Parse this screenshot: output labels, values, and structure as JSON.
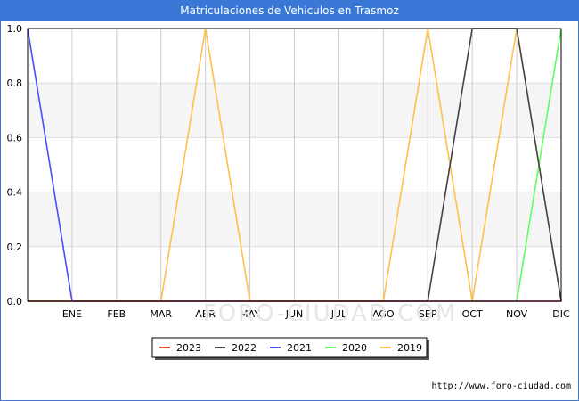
{
  "chart_data": {
    "type": "line",
    "title": "Matriculaciones de Vehiculos en Trasmoz",
    "xlabel": "",
    "ylabel": "",
    "ylim": [
      0,
      1
    ],
    "yticks": [
      0.0,
      0.2,
      0.4,
      0.6,
      0.8,
      1.0
    ],
    "ytick_labels": [
      "0.0",
      "0.2",
      "0.4",
      "0.6",
      "0.8",
      "1.0"
    ],
    "categories": [
      "",
      "ENE",
      "FEB",
      "MAR",
      "ABR",
      "MAY",
      "JUN",
      "JUL",
      "AGO",
      "SEP",
      "OCT",
      "NOV",
      "DIC"
    ],
    "grid": true,
    "legend_position": "bottom",
    "watermark": "FORO-CIUDAD.COM",
    "series": [
      {
        "name": "2023",
        "color": "#ff3b3b",
        "values": [
          0,
          0,
          0,
          0,
          0,
          0,
          0,
          0,
          0,
          0,
          0,
          0,
          0
        ]
      },
      {
        "name": "2022",
        "color": "#444444",
        "values": [
          0,
          0,
          0,
          0,
          0,
          0,
          0,
          0,
          0,
          0,
          1,
          1,
          0
        ]
      },
      {
        "name": "2021",
        "color": "#4a4aff",
        "values": [
          1,
          0,
          0,
          0,
          0,
          0,
          0,
          0,
          0,
          0,
          0,
          0,
          0
        ]
      },
      {
        "name": "2020",
        "color": "#5cff5c",
        "values": [
          0,
          0,
          0,
          0,
          0,
          0,
          0,
          0,
          0,
          0,
          0,
          0,
          1
        ]
      },
      {
        "name": "2019",
        "color": "#ffc04a",
        "values": [
          0,
          0,
          0,
          0,
          1,
          0,
          0,
          0,
          0,
          1,
          0,
          1,
          0
        ]
      }
    ]
  },
  "footer": {
    "url": "http://www.foro-ciudad.com"
  }
}
